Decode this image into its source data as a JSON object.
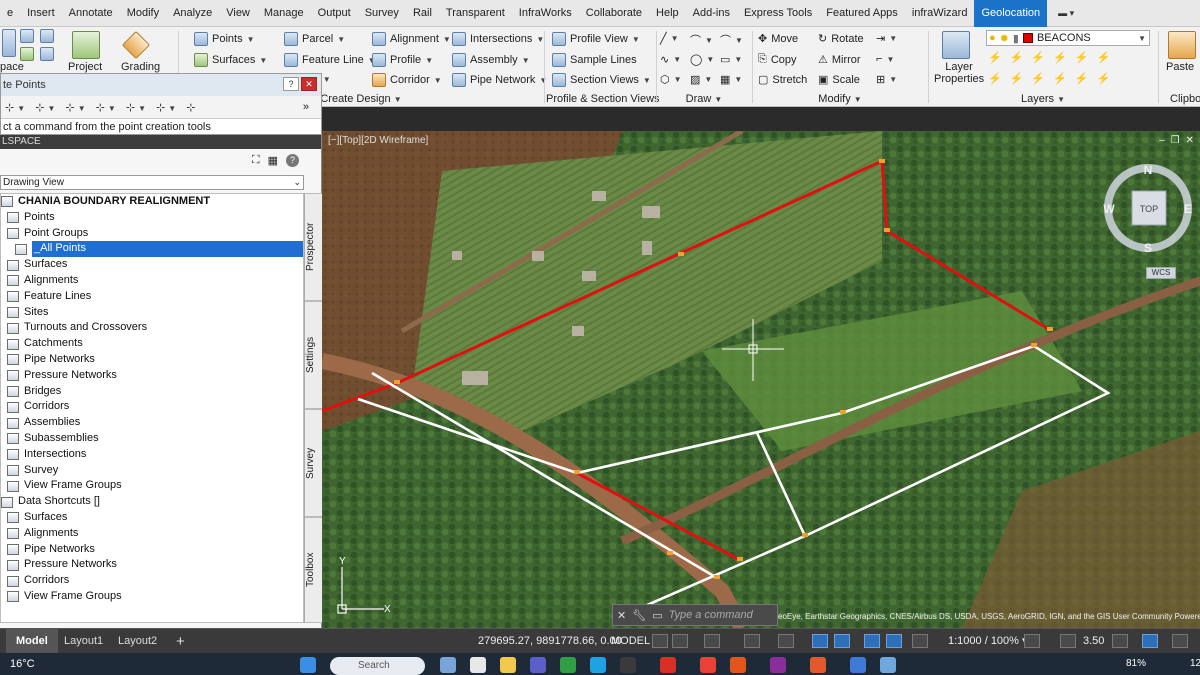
{
  "ribbon": {
    "tabs": [
      "e",
      "Insert",
      "Annotate",
      "Modify",
      "Analyze",
      "View",
      "Manage",
      "Output",
      "Survey",
      "Rail",
      "Transparent",
      "InfraWorks",
      "Collaborate",
      "Help",
      "Add-ins",
      "Express Tools",
      "Featured Apps",
      "infraWizard",
      "Geolocation"
    ],
    "active_tab": "Geolocation",
    "left": {
      "space_label": "pace",
      "project_label": "Project",
      "grading_label": "Grading"
    },
    "create_design": {
      "title": "Create Design",
      "points": "Points",
      "surfaces": "Surfaces",
      "grading_cut": "ing",
      "parcel": "Parcel",
      "feature_line": "Feature Line",
      "corridor": "Corridor",
      "alignment": "Alignment",
      "profile": "Profile",
      "pipe_network": "Pipe Network",
      "intersections": "Intersections",
      "assembly": "Assembly"
    },
    "profile_section": {
      "title": "Profile & Section Views",
      "profile_view": "Profile View",
      "sample_lines": "Sample Lines",
      "section_views": "Section Views"
    },
    "draw": {
      "title": "Draw"
    },
    "modify": {
      "title": "Modify",
      "move": "Move",
      "rotate": "Rotate",
      "copy": "Copy",
      "mirror": "Mirror",
      "stretch": "Stretch",
      "scale": "Scale"
    },
    "layers": {
      "title": "Layers",
      "layer_properties": "Layer\nProperties",
      "current_layer": "BEACONS",
      "layer_color": "#e00000"
    },
    "clipboard": {
      "paste": "Paste",
      "title": "Clipbo"
    }
  },
  "point_tools": {
    "title": "te Points",
    "prompt": "ct a command from the point creation tools"
  },
  "toolspace": {
    "title": "LSPACE",
    "view": "Drawing View",
    "tabs": [
      "Prospector",
      "Settings",
      "Survey",
      "Toolbox"
    ],
    "tree": [
      {
        "label": "CHANIA BOUNDARY REALIGNMENT",
        "indent": 0,
        "bold": true
      },
      {
        "label": "Points",
        "indent": 1
      },
      {
        "label": "Point Groups",
        "indent": 1
      },
      {
        "label": "_All Points",
        "indent": 2,
        "selected": true
      },
      {
        "label": "Surfaces",
        "indent": 1
      },
      {
        "label": "Alignments",
        "indent": 1
      },
      {
        "label": "Feature Lines",
        "indent": 1
      },
      {
        "label": "Sites",
        "indent": 1
      },
      {
        "label": "Turnouts and Crossovers",
        "indent": 1
      },
      {
        "label": "Catchments",
        "indent": 1
      },
      {
        "label": "Pipe Networks",
        "indent": 1
      },
      {
        "label": "Pressure Networks",
        "indent": 1
      },
      {
        "label": "Bridges",
        "indent": 1
      },
      {
        "label": "Corridors",
        "indent": 1
      },
      {
        "label": "Assemblies",
        "indent": 1
      },
      {
        "label": "Subassemblies",
        "indent": 1
      },
      {
        "label": "Intersections",
        "indent": 1
      },
      {
        "label": "Survey",
        "indent": 1
      },
      {
        "label": "View Frame Groups",
        "indent": 1
      },
      {
        "label": "Data Shortcuts []",
        "indent": 0
      },
      {
        "label": "Surfaces",
        "indent": 1
      },
      {
        "label": "Alignments",
        "indent": 1
      },
      {
        "label": "Pipe Networks",
        "indent": 1
      },
      {
        "label": "Pressure Networks",
        "indent": 1
      },
      {
        "label": "Corridors",
        "indent": 1
      },
      {
        "label": "View Frame Groups",
        "indent": 1
      }
    ]
  },
  "viewport": {
    "label": "[−][Top][2D Wireframe]",
    "viewcube": {
      "n": "N",
      "s": "S",
      "e": "E",
      "w": "W",
      "face": "TOP",
      "wcs": "WCS"
    },
    "command_placeholder": "Type a command",
    "attribution": "eoEye, Earthstar Geographics, CNES/Airbus DS, USDA, USGS, AeroGRID, IGN, and the GIS User Community Powered by Esri",
    "colors": {
      "boundary_red": "#e01010",
      "boundary_white": "#ffffff"
    }
  },
  "status": {
    "layouts": [
      "Model",
      "Layout1",
      "Layout2"
    ],
    "active_layout": "Model",
    "coords": "279695.27, 9891778.66, 0.00",
    "model": "MODEL",
    "scale": "1:1000 / 100%",
    "anno": "3.50"
  },
  "taskbar": {
    "temperature": "16°C",
    "search": "Search",
    "battery": "81%",
    "clock": "12"
  }
}
